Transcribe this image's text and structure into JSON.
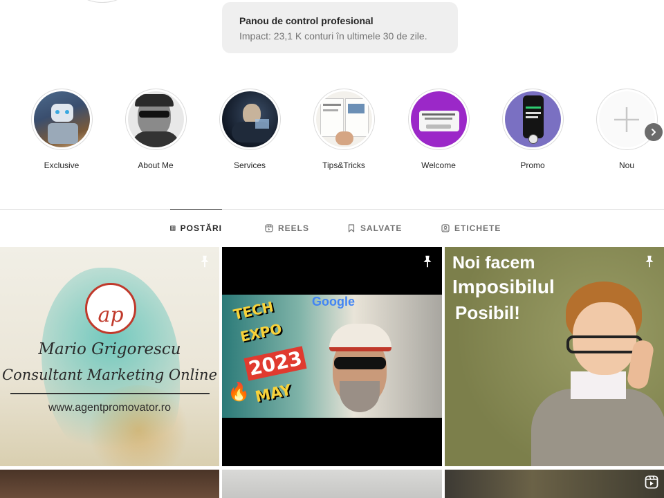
{
  "dashboard": {
    "title": "Panou de control profesional",
    "subtitle": "Impact: 23,1 K conturi în ultimele 30 de zile."
  },
  "highlights": [
    {
      "label": "Exclusive"
    },
    {
      "label": "About Me"
    },
    {
      "label": "Services"
    },
    {
      "label": "Tips&Tricks"
    },
    {
      "label": "Welcome"
    },
    {
      "label": "Promo"
    },
    {
      "label": "Nou"
    }
  ],
  "tabs": [
    {
      "label": "POSTĂRI",
      "icon": "grid-icon",
      "active": true
    },
    {
      "label": "REELS",
      "icon": "reels-icon",
      "active": false
    },
    {
      "label": "SALVATE",
      "icon": "bookmark-icon",
      "active": false
    },
    {
      "label": "ETICHETE",
      "icon": "tagged-icon",
      "active": false
    }
  ],
  "posts": {
    "p1": {
      "logo": "ap",
      "name": "Mario Grigorescu",
      "role": "Consultant Marketing Online",
      "url": "www.agentpromovator.ro",
      "pinned": true
    },
    "p2": {
      "line1": "TECH",
      "line2": "EXPO",
      "year": "2023",
      "month": "MAY",
      "sign": "Google",
      "pinned": true
    },
    "p3": {
      "line1": "Noi facem",
      "line2": "Imposibilul",
      "line3": "Posibil!",
      "pinned": true
    }
  },
  "colors": {
    "accent": "#262626",
    "muted": "#737373",
    "divider": "#dbdbdb",
    "dashboard_bg": "#efefef"
  }
}
